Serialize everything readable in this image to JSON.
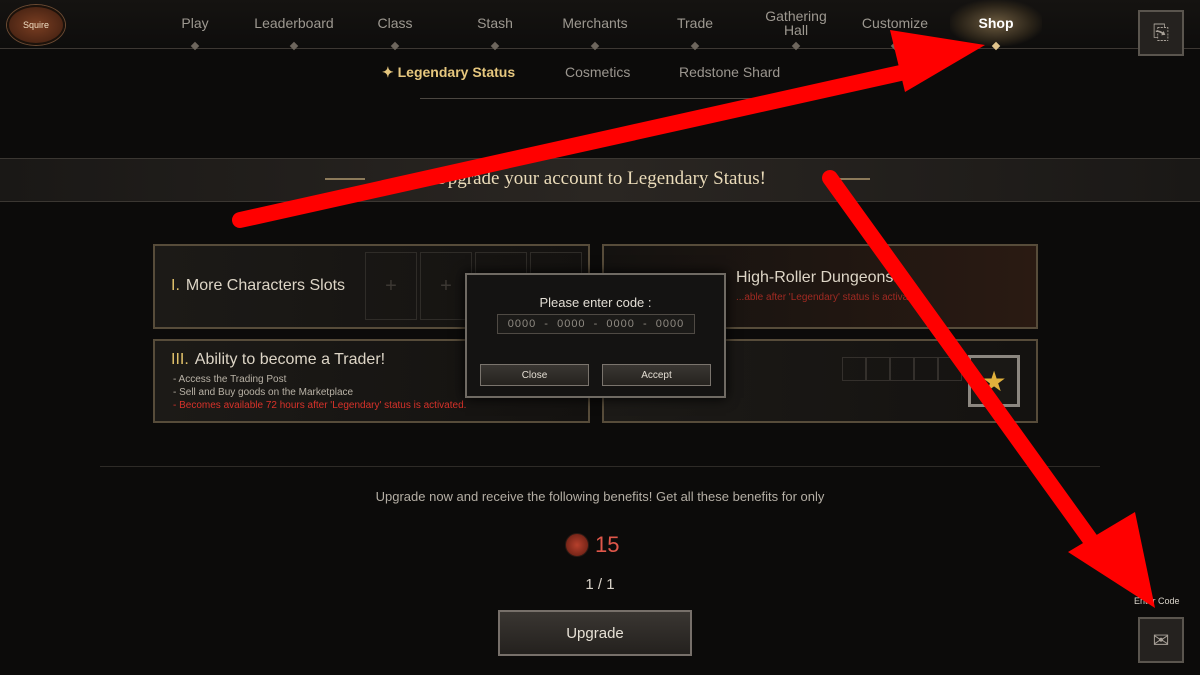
{
  "profile": {
    "badge": "Squire"
  },
  "nav": {
    "items": [
      "Play",
      "Leaderboard",
      "Class",
      "Stash",
      "Merchants",
      "Trade",
      "Gathering Hall",
      "Customize",
      "Shop"
    ],
    "active": "Shop"
  },
  "subtabs": [
    "Legendary Status",
    "Cosmetics",
    "Redstone Shard"
  ],
  "banner": {
    "title": "Upgrade your account to Legendary Status!"
  },
  "benefits": {
    "one": {
      "numeral": "I.",
      "label": "More Characters Slots"
    },
    "two": {
      "label": "High-Roller Dungeons!",
      "note": "...able after 'Legendary' status is activated."
    },
    "three": {
      "numeral": "III.",
      "label": "Ability to become a Trader!",
      "bullets": [
        "- Access the Trading Post",
        "- Sell and Buy goods on the Marketplace",
        "- Becomes available 72 hours after 'Legendary' status is activated."
      ]
    }
  },
  "modal": {
    "title": "Please enter code :",
    "placeholder": "0000  -  0000  -  0000  -  0000",
    "close_label": "Close",
    "accept_label": "Accept"
  },
  "offer": {
    "text": "Upgrade now and receive the following benefits! Get all these benefits for only",
    "price": "15",
    "currency_icon": "redstone-shard-icon"
  },
  "pager": "1 / 1",
  "upgrade_label": "Upgrade",
  "enter_code_label": "Enter Code",
  "annotation_color": "#ff0000",
  "accent_color": "#e6c77e"
}
